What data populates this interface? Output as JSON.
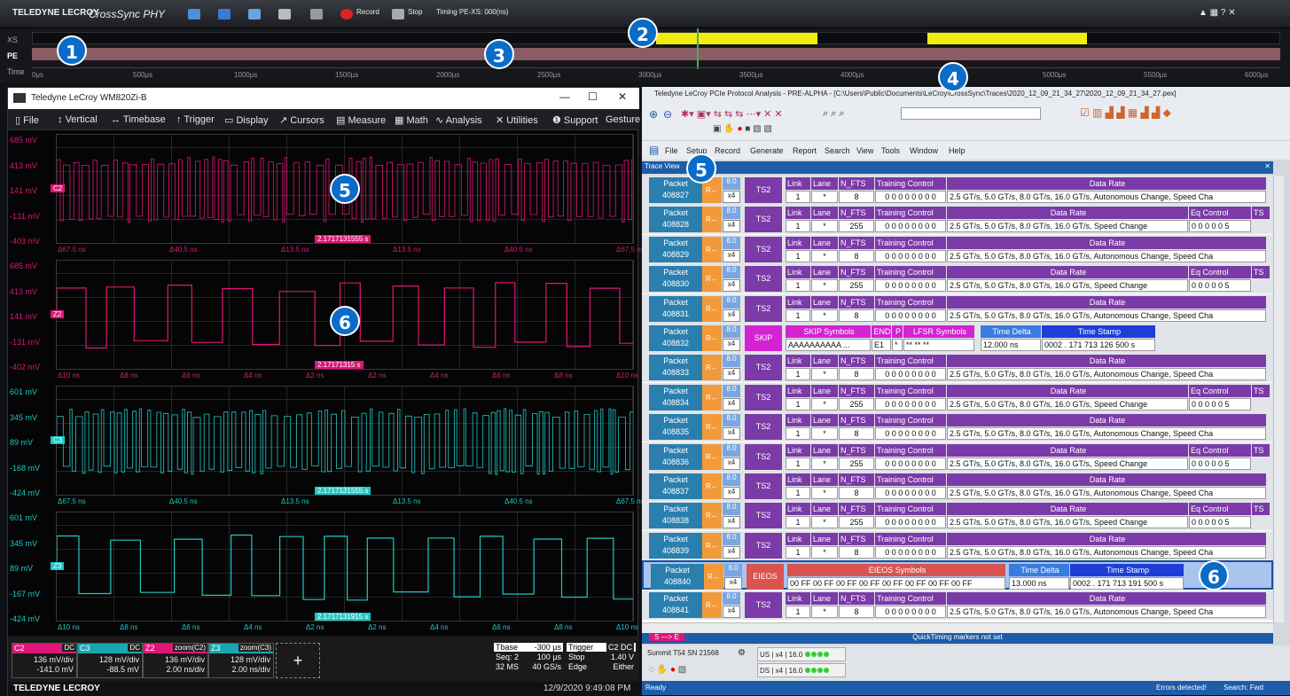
{
  "app": {
    "brand": "TELEDYNE LECROY",
    "product": "CrossSync PHY",
    "toolbar": {
      "record": "Record",
      "stop": "Stop",
      "timing": "Timing PE-XS: 000(ns)"
    }
  },
  "timeline": {
    "lanes": [
      "XS",
      "PE",
      "Time"
    ],
    "ticks": [
      "0µs",
      "500µs",
      "1000µs",
      "1500µs",
      "2000µs",
      "2500µs",
      "3000µs",
      "3500µs",
      "4000µs",
      "4500µs",
      "5000µs",
      "5500µs",
      "6000µs"
    ]
  },
  "callouts": [
    "1",
    "2",
    "3",
    "4",
    "5",
    "5",
    "6",
    "6"
  ],
  "scope": {
    "title": "Teledyne LeCroy WM820Zi-B",
    "menu": [
      "File",
      "Vertical",
      "Timebase",
      "Trigger",
      "Display",
      "Cursors",
      "Measure",
      "Math",
      "Analysis",
      "Utilities",
      "Support",
      "Gesture"
    ],
    "traces": [
      {
        "color": "#e0157a",
        "y": [
          "685 mV",
          "413 mV",
          "141 mV",
          "-131 mV",
          "-403 mV"
        ],
        "x": [
          "Δ67.5 ns",
          "Δ40.5 ns",
          "Δ13.5 ns",
          "Δ13.5 ns",
          "Δ40.5 ns",
          "Δ67.5 ns"
        ],
        "tag": "2.1717131555 s",
        "ch": "C2"
      },
      {
        "color": "#e0157a",
        "y": [
          "685 mV",
          "413 mV",
          "141 mV",
          "-131 mV",
          "-402 mV"
        ],
        "x": [
          "Δ10 ns",
          "Δ8 ns",
          "Δ6 ns",
          "Δ4 ns",
          "Δ2 ns",
          "Δ2 ns",
          "Δ4 ns",
          "Δ6 ns",
          "Δ8 ns",
          "Δ10 ns"
        ],
        "tag": "2.17171315 s",
        "ch": "Z2"
      },
      {
        "color": "#1ec8c8",
        "y": [
          "601 mV",
          "345 mV",
          "89 mV",
          "-168 mV",
          "-424 mV"
        ],
        "x": [
          "Δ67.5 ns",
          "Δ40.5 ns",
          "Δ13.5 ns",
          "Δ13.5 ns",
          "Δ40.5 ns",
          "Δ67.5 ns"
        ],
        "tag": "2.1717131555 s",
        "ch": "C3"
      },
      {
        "color": "#1ec8c8",
        "y": [
          "601 mV",
          "345 mV",
          "89 mV",
          "-167 mV",
          "-424 mV"
        ],
        "x": [
          "Δ10 ns",
          "Δ8 ns",
          "Δ6 ns",
          "Δ4 ns",
          "Δ2 ns",
          "Δ2 ns",
          "Δ4 ns",
          "Δ6 ns",
          "Δ8 ns",
          "Δ10 ns"
        ],
        "tag": "2.1717131915 s",
        "ch": "Z3"
      }
    ],
    "channels": [
      {
        "name": "C2",
        "badge": "DC",
        "l1": "136 mV/div",
        "l2": "-141.0 mV",
        "color": "#e0157a"
      },
      {
        "name": "C3",
        "badge": "DC",
        "l1": "128 mV/div",
        "l2": "-88.5 mV",
        "color": "#1aa6b0"
      },
      {
        "name": "Z2",
        "badge": "zoom(C2)",
        "l1": "136 mV/div",
        "l2": "2.00 ns/div",
        "color": "#e0157a"
      },
      {
        "name": "Z3",
        "badge": "zoom(C3)",
        "l1": "128 mV/div",
        "l2": "2.00 ns/div",
        "color": "#1aa6b0"
      }
    ],
    "add": "+",
    "tbase": {
      "label": "Tbase",
      "val": "-300 µs",
      "r1a": "Seq: 2",
      "r1b": "100 µs",
      "r2a": "32 MS",
      "r2b": "40 GS/s"
    },
    "trigger": {
      "label": "Trigger",
      "badge": "C2 DC",
      "r1a": "Stop",
      "r1b": "1.40 V",
      "r2a": "Edge",
      "r2b": "Either"
    },
    "footer_brand": "TELEDYNE LECROY",
    "datetime": "12/9/2020 9:49:08 PM"
  },
  "pa": {
    "title": "Teledyne LeCroy PCIe Protocol Analysis - PRE-ALPHA - [C:\\Users\\Public\\Documents\\LeCroy\\CrossSync\\Traces\\2020_12_09_21_34_27\\2020_12_09_21_34_27.pex]",
    "menu": [
      "File",
      "Setup",
      "Record",
      "Generate",
      "Report",
      "Search",
      "View",
      "Tools",
      "Window",
      "Help"
    ],
    "traceview": "Trace View",
    "rows": [
      {
        "id": "408827",
        "t": "TS2",
        "ft": "8",
        "ec": false
      },
      {
        "id": "408828",
        "t": "TS2",
        "ft": "255",
        "ec": true
      },
      {
        "id": "408829",
        "t": "TS2",
        "ft": "8",
        "ec": false
      },
      {
        "id": "408830",
        "t": "TS2",
        "ft": "255",
        "ec": true
      },
      {
        "id": "408831",
        "t": "TS2",
        "ft": "8",
        "ec": false
      },
      {
        "id": "408832",
        "t": "SKIP"
      },
      {
        "id": "408833",
        "t": "TS2",
        "ft": "8",
        "ec": false
      },
      {
        "id": "408834",
        "t": "TS2",
        "ft": "255",
        "ec": true
      },
      {
        "id": "408835",
        "t": "TS2",
        "ft": "8",
        "ec": false
      },
      {
        "id": "408836",
        "t": "TS2",
        "ft": "255",
        "ec": true
      },
      {
        "id": "408837",
        "t": "TS2",
        "ft": "8",
        "ec": false
      },
      {
        "id": "408838",
        "t": "TS2",
        "ft": "255",
        "ec": true
      },
      {
        "id": "408839",
        "t": "TS2",
        "ft": "8",
        "ec": false
      },
      {
        "id": "408840",
        "t": "EIEOS"
      },
      {
        "id": "408841",
        "t": "TS2",
        "ft": "8",
        "ec": false
      }
    ],
    "cols": {
      "packet": "Packet",
      "dir": "R←",
      "speed": "8.0",
      "width": "x4",
      "link": "Link",
      "lane": "Lane",
      "nfts": "N_FTS",
      "tc": "Training Control",
      "dr": "Data Rate",
      "ecl": "Eq Control",
      "ts": "TS",
      "lv": "1",
      "lanev": "*",
      "tcv": "0 0 0 0 0 0 0 0",
      "drv_a": "2.5 GT/s, 5.0 GT/s, 8.0 GT/s, 16.0 GT/s, Autonomous Change, Speed Cha",
      "drv_b": "2.5 GT/s, 5.0 GT/s, 8.0 GT/s, 16.0 GT/s, Speed Change",
      "ecv": "0 0 0 0 0 5",
      "skip": {
        "sym": "SKIP Symbols",
        "symv": "AAAAAAAAAA ...",
        "end": "END",
        "endv": "E1",
        "p": "P",
        "pv": "*",
        "lfsr": "LFSR Symbols",
        "lfsrv": "** ** **",
        "td": "Time Delta",
        "tdv": "12.000 ns",
        "tsl": "Time Stamp",
        "tsv": "0002 . 171 713 126 500 s"
      },
      "eieos": {
        "sym": "EIEOS Symbols",
        "symv": "00 FF 00 FF 00 FF 00 FF 00 FF 00 FF 00 FF 00 FF",
        "td": "Time Delta",
        "tdv": "13.000 ns",
        "tsl": "Time Stamp",
        "tsv": "0002 . 171 713 191 500 s"
      }
    },
    "quick": "QuickTiming markers not set",
    "se": "S —> E",
    "summit": "Summit T54 SN 21568",
    "links": [
      {
        "dir": "US",
        "w": "x4",
        "s": "16.0"
      },
      {
        "dir": "DS",
        "w": "x4",
        "s": "16.0"
      }
    ],
    "status_left": "Ready",
    "status_err": "Errors detected!",
    "status_search": "Search: Fwd"
  }
}
